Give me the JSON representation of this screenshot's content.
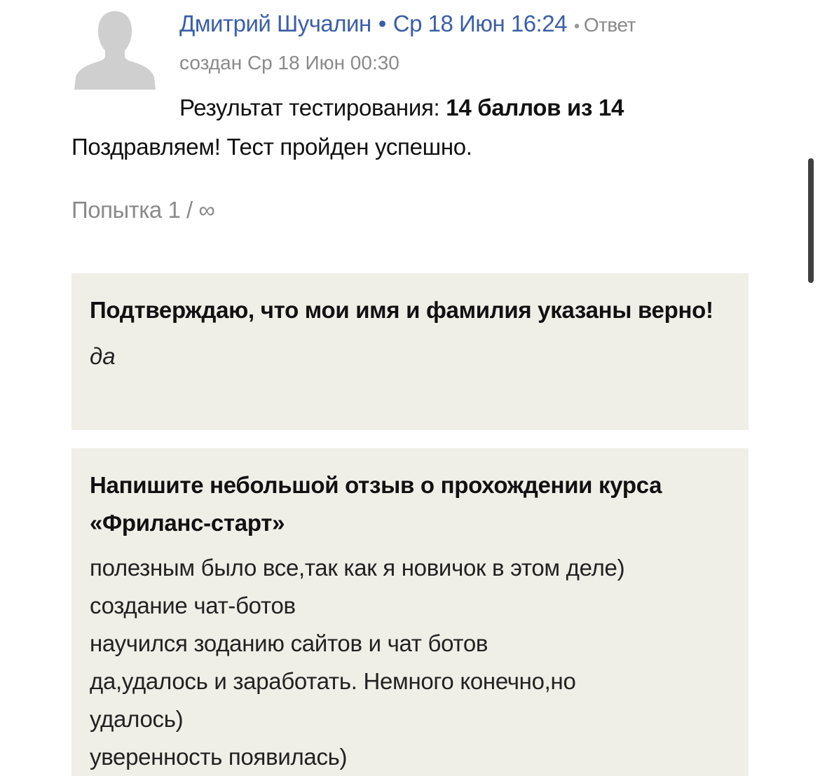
{
  "post": {
    "author": "Дмитрий Шучалин",
    "separator": "•",
    "datetime": "Ср 18 Июн 16:24",
    "reply_separator": "•",
    "reply_label": "Ответ",
    "created": "создан Ср 18 Июн 00:30",
    "result_label": "Результат тестирования:",
    "result_value": "14 баллов из 14",
    "congrats": "Поздравляем! Тест пройден успешно.",
    "attempt": "Попытка 1 / ∞"
  },
  "answers": [
    {
      "question": "Подтверждаю, что мои имя и фамилия указаны верно!",
      "answer": "да"
    },
    {
      "question": "Напишите небольшой отзыв о прохождении курса «Фриланс-старт»",
      "answer_lines": [
        "полезным было все,так как я новичок в этом деле)",
        "создание чат-ботов",
        "научился зоданию сайтов и чат ботов",
        "да,удалось и заработать. Немного конечно,но",
        "удалось)",
        "уверенность появилась)"
      ]
    }
  ],
  "icons": {
    "avatar": "default-user-avatar-icon"
  },
  "colors": {
    "link": "#3a5fa8",
    "muted": "#8a8a8a",
    "card_bg": "#f0efe7"
  }
}
